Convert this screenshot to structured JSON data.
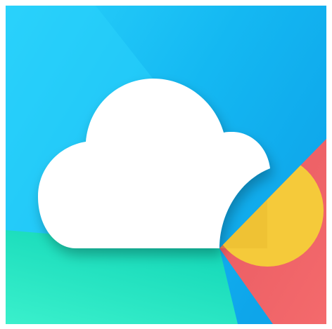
{
  "icon": {
    "name": "cloud-weather-app-icon",
    "colors": {
      "sky_light": "#2ad2fb",
      "sky_mid": "#14b8f2",
      "sky_deep": "#0ea5ea",
      "teal_light": "#3af0cc",
      "teal_dark": "#14d8b8",
      "coral": "#f46a6c",
      "coral_dark": "#e85a62",
      "sun_yellow": "#f5ca3a",
      "sun_shade": "#e6b52c",
      "cloud_white": "#ffffff"
    }
  }
}
